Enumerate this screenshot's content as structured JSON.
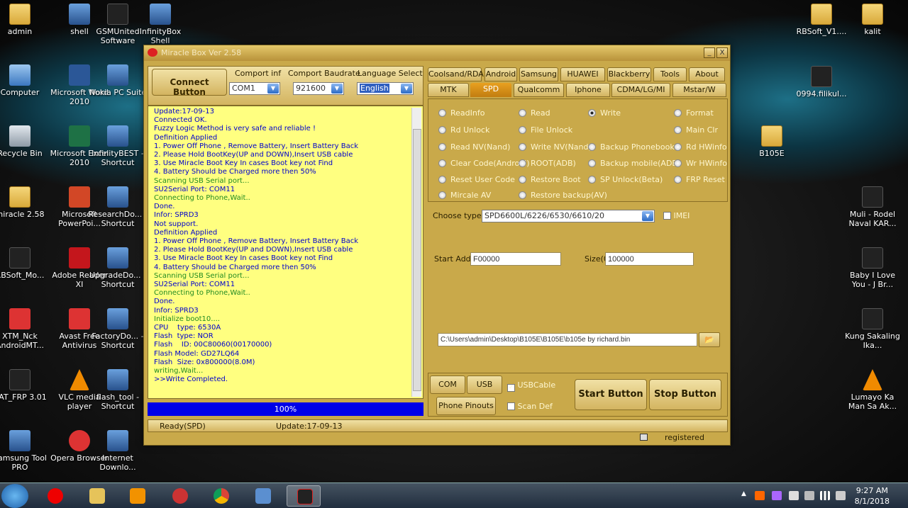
{
  "desktop_icons": [
    {
      "label": "admin"
    },
    {
      "label": "shell"
    },
    {
      "label": "GSMUnited Software"
    },
    {
      "label": "InfinityBox Shell"
    },
    {
      "label": "Computer"
    },
    {
      "label": "Microsoft Word 2010"
    },
    {
      "label": "Nokia PC Suite"
    },
    {
      "label": "Recycle Bin"
    },
    {
      "label": "Microsoft Excel 2010"
    },
    {
      "label": "InfinityBEST - Shortcut"
    },
    {
      "label": "miracle 2.58"
    },
    {
      "label": "Microsoft PowerPoi..."
    },
    {
      "label": "ResearchDo... - Shortcut"
    },
    {
      "label": "RBSoft_Mo..."
    },
    {
      "label": "Adobe Reader XI"
    },
    {
      "label": "UpgradeDo... - Shortcut"
    },
    {
      "label": "XTM_Nck AndroidMT..."
    },
    {
      "label": "Avast Free Antivirus"
    },
    {
      "label": "FactoryDo... - Shortcut"
    },
    {
      "label": "UAT_FRP 3.01"
    },
    {
      "label": "VLC media player"
    },
    {
      "label": "flash_tool - Shortcut"
    },
    {
      "label": "Samsung Tool PRO"
    },
    {
      "label": "Opera Browser"
    },
    {
      "label": "Internet Downlo..."
    },
    {
      "label": "RBSoft_V1...."
    },
    {
      "label": "kalit"
    },
    {
      "label": "0994.filikul..."
    },
    {
      "label": "B105E"
    },
    {
      "label": "Muli - Rodel Naval KAR..."
    },
    {
      "label": "Baby I Love You - J Br..."
    },
    {
      "label": "Kung Sakaling Ika..."
    },
    {
      "label": "Lumayo Ka Man Sa Ak..."
    }
  ],
  "window": {
    "title": "Miracle Box Ver 2.58",
    "minimize": "_",
    "close": "X",
    "connect_button": "Connect Button",
    "comport_inf_label": "Comport inf",
    "comport_inf_value": "COM1",
    "baudrate_label": "Comport Baudrate",
    "baudrate_value": "921600",
    "language_label": "Language Select",
    "language_value": "English",
    "log_lines": [
      {
        "text": "Update:17-09-13",
        "color": "blue"
      },
      {
        "text": "Connected OK.",
        "color": "blue"
      },
      {
        "text": "Fuzzy Logic Method is very safe and reliable !",
        "color": "blue"
      },
      {
        "text": "Definition Applied",
        "color": "blue"
      },
      {
        "text": "1. Power Off Phone , Remove Battery, Insert Battery Back",
        "color": "blue"
      },
      {
        "text": "2. Please Hold BootKey(UP and DOWN),Insert USB cable",
        "color": "blue"
      },
      {
        "text": "3. Use Miracle Boot Key In cases Boot key not Find",
        "color": "blue"
      },
      {
        "text": "4. Battery Should be Charged more then 50%",
        "color": "blue"
      },
      {
        "text": "Scanning USB Serial port...",
        "color": "green"
      },
      {
        "text": "SU2Serial Port: COM11",
        "color": "blue"
      },
      {
        "text": "Connecting to Phone,Wait..",
        "color": "green"
      },
      {
        "text": "Done.",
        "color": "blue"
      },
      {
        "text": "Infor: SPRD3",
        "color": "blue"
      },
      {
        "text": "Not support.",
        "color": "blue"
      },
      {
        "text": "Definition Applied",
        "color": "blue"
      },
      {
        "text": "1. Power Off Phone , Remove Battery, Insert Battery Back",
        "color": "blue"
      },
      {
        "text": "2. Please Hold BootKey(UP and DOWN),Insert USB cable",
        "color": "blue"
      },
      {
        "text": "3. Use Miracle Boot Key In cases Boot key not Find",
        "color": "blue"
      },
      {
        "text": "4. Battery Should be Charged more then 50%",
        "color": "blue"
      },
      {
        "text": "Scanning USB Serial port...",
        "color": "green"
      },
      {
        "text": "SU2Serial Port: COM11",
        "color": "blue"
      },
      {
        "text": "Connecting to Phone,Wait..",
        "color": "green"
      },
      {
        "text": "Done.",
        "color": "blue"
      },
      {
        "text": "Infor: SPRD3",
        "color": "blue"
      },
      {
        "text": "Initialize boot10....",
        "color": "green"
      },
      {
        "text": "CPU    type: 6530A",
        "color": "blue"
      },
      {
        "text": "Flash  type: NOR",
        "color": "blue"
      },
      {
        "text": "Flash    ID: 00C80060(00170000)",
        "color": "blue"
      },
      {
        "text": "Flash Model: GD27LQ64",
        "color": "blue"
      },
      {
        "text": "Flash  Size: 0x800000(8.0M)",
        "color": "blue"
      },
      {
        "text": "writing,Wait...",
        "color": "green"
      },
      {
        "text": ">>Write Completed.",
        "color": "blue"
      }
    ],
    "progress_text": "100%",
    "progress_value": 1.0,
    "status_mode": "Ready(SPD)",
    "status_update": "Update:17-09-13",
    "status_registered": "registered",
    "tabs_row1": [
      "Coolsand/RDA",
      "Android",
      "Samsung",
      "HUAWEI",
      "Blackberry",
      "Tools",
      "About"
    ],
    "tabs_row2": [
      "MTK",
      "SPD",
      "Qualcomm",
      "Iphone",
      "CDMA/LG/MI",
      "Mstar/W"
    ],
    "active_tab": "SPD",
    "radio_options": [
      "ReadInfo",
      "Read",
      "Write",
      "Format",
      "Rd Unlock",
      "File Unlock",
      "Main Clr",
      "Read NV(Nand)",
      "Write NV(Nand)",
      "Backup Phonebook",
      "Rd HWinfo",
      "Clear Code(Android)",
      "ROOT(ADB)",
      "Backup mobile(ADB)",
      "Wr HWinfo",
      "Reset User Code",
      "Restore Boot",
      "SP Unlock(Beta)",
      "FRP Reset",
      "Mircale AV",
      "Restore backup(AV)"
    ],
    "selected_radio": "Write",
    "choose_type_label": "Choose  type",
    "choose_type_value": "SPD6600L/6226/6530/6610/20",
    "imei_label": "IMEI",
    "start_addr_label": "Start Addr(0",
    "start_addr_value": "F00000",
    "size_label": "Size(0",
    "size_value": "100000",
    "file_path": "C:\\Users\\admin\\Desktop\\B105E\\B105E\\b105e by richard.bin",
    "com_scan": "COM Scan",
    "usb_scan": "USB Scan",
    "usbcable_label": "USBCable",
    "phone_pinouts": "Phone Pinouts",
    "scan_def_label": "Scan Def",
    "start_button": "Start Button",
    "stop_button": "Stop Button"
  },
  "taskbar": {
    "time": "9:27 AM",
    "date": "8/1/2018"
  }
}
